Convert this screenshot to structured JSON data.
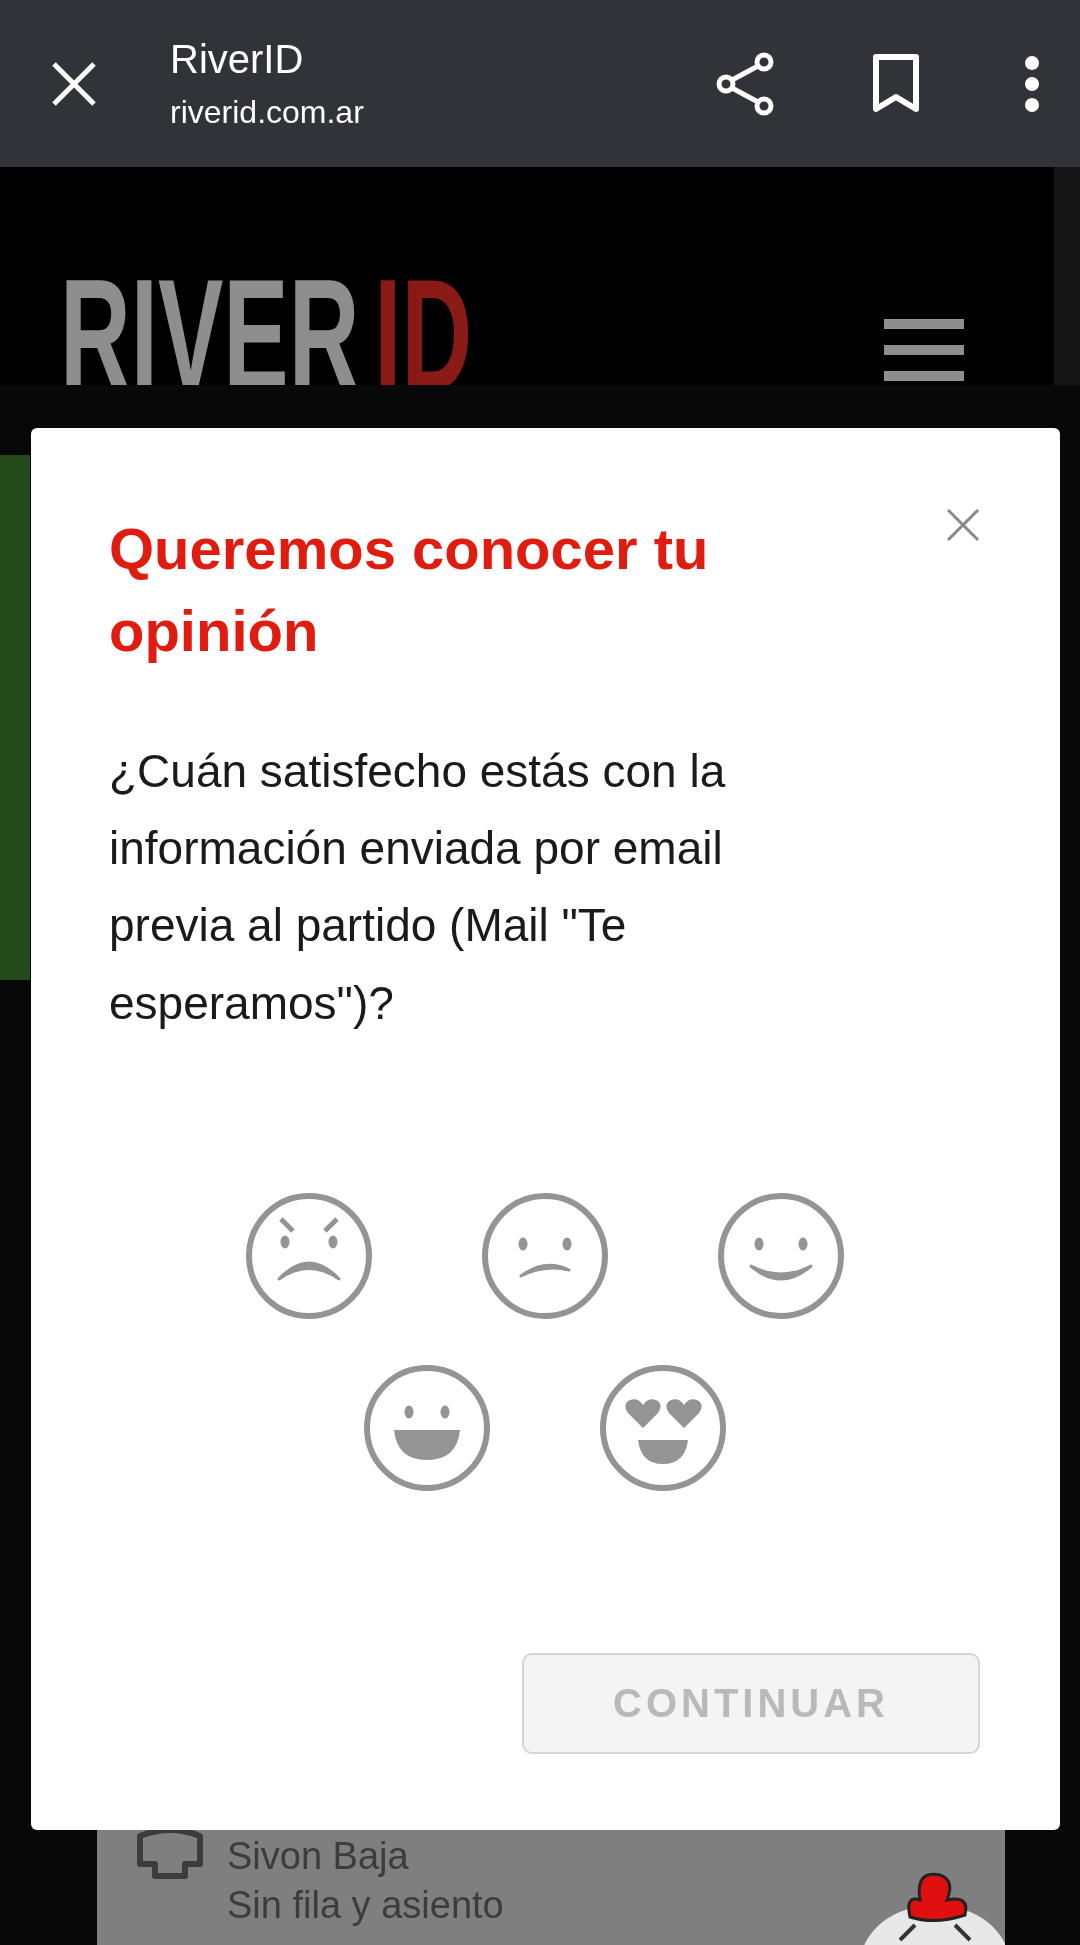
{
  "browser_bar": {
    "title": "RiverID",
    "url": "riverid.com.ar"
  },
  "site_header": {
    "logo_main": "RIVER",
    "logo_accent": "ID"
  },
  "background_card": {
    "line_1": "Sivon Baja",
    "line_2": "Sin fila y asiento"
  },
  "modal": {
    "title": "Queremos conocer tu opinión",
    "question": "¿Cuán satisfecho estás con la información enviada por email previa al partido (Mail \"Te esperamos\")?",
    "faces": [
      {
        "kind": "angry"
      },
      {
        "kind": "sad"
      },
      {
        "kind": "smile"
      },
      {
        "kind": "grin"
      },
      {
        "kind": "love"
      }
    ],
    "continue_button": {
      "label": "CONTINUAR",
      "disabled": true
    }
  }
}
